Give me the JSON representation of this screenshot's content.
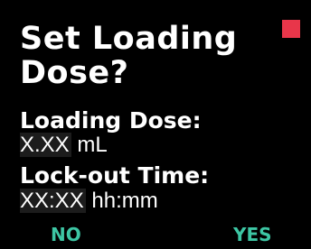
{
  "dialog": {
    "title_line1": "Set Loading",
    "title_line2": "Dose?",
    "status_color": "#e8364a"
  },
  "fields": {
    "loading_dose": {
      "label": "Loading Dose:",
      "value": "X.XX",
      "unit": " mL"
    },
    "lockout_time": {
      "label": "Lock-out Time:",
      "value": "XX:XX",
      "unit": " hh:mm"
    }
  },
  "softkeys": {
    "left": "NO",
    "right": "YES",
    "color": "#3dc6a4"
  }
}
